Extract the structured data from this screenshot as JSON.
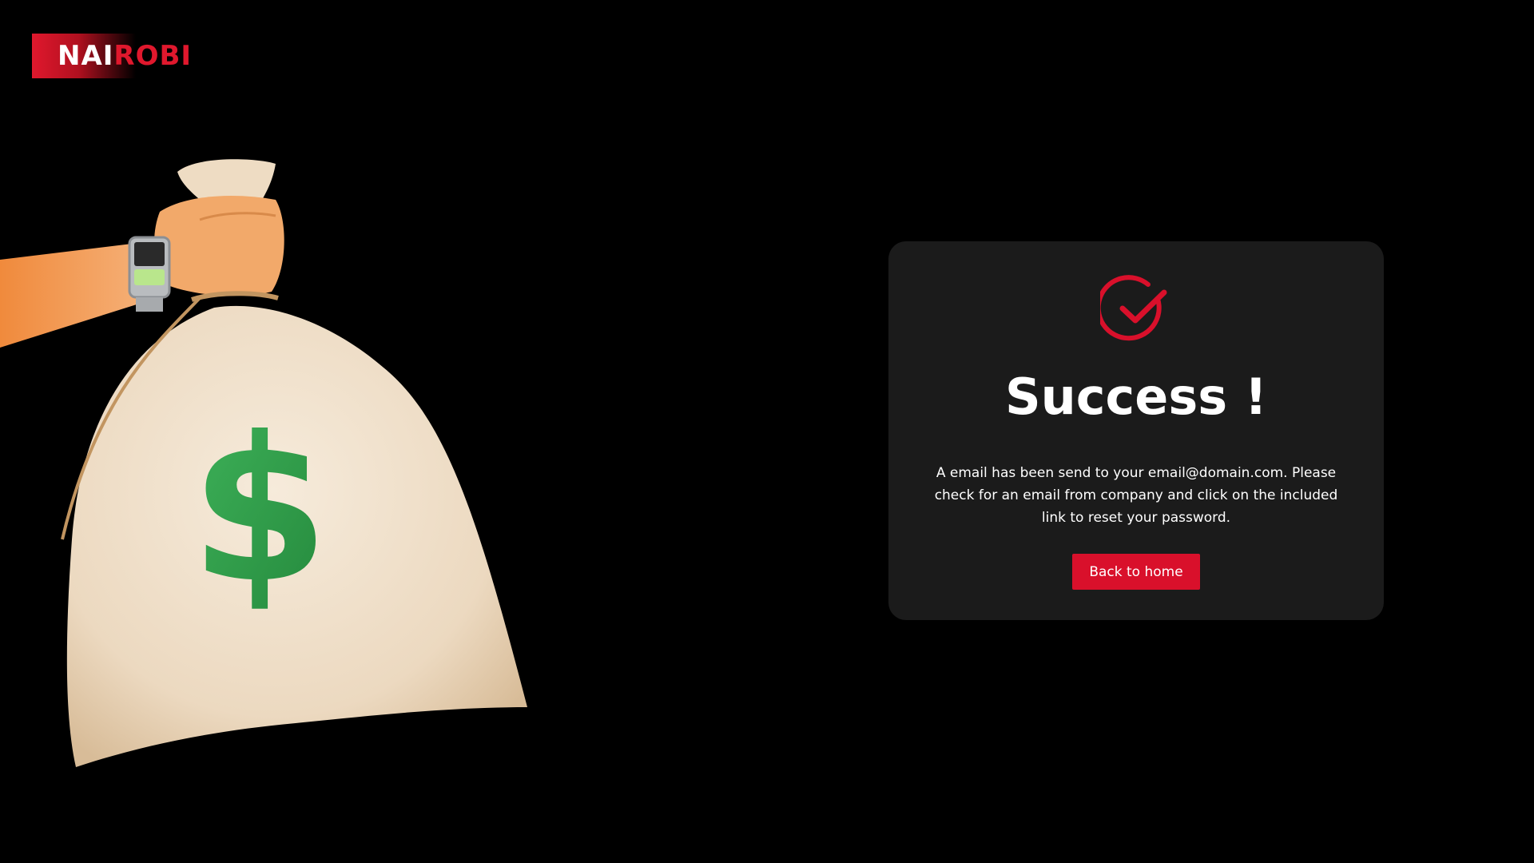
{
  "brand": {
    "logo_part1": "NAI",
    "logo_part2": "ROBI",
    "accent_color": "#e0182d"
  },
  "illustration": {
    "icon": "money-bag-icon",
    "symbol": "$"
  },
  "card": {
    "icon": "check-circle-icon",
    "title": "Success !",
    "message": "A email has been send to your email@domain.com. Please check for an email from company and click on the included link to reset your password.",
    "button_label": "Back to home",
    "button_color": "#d9102b",
    "background": "#1b1b1b"
  }
}
